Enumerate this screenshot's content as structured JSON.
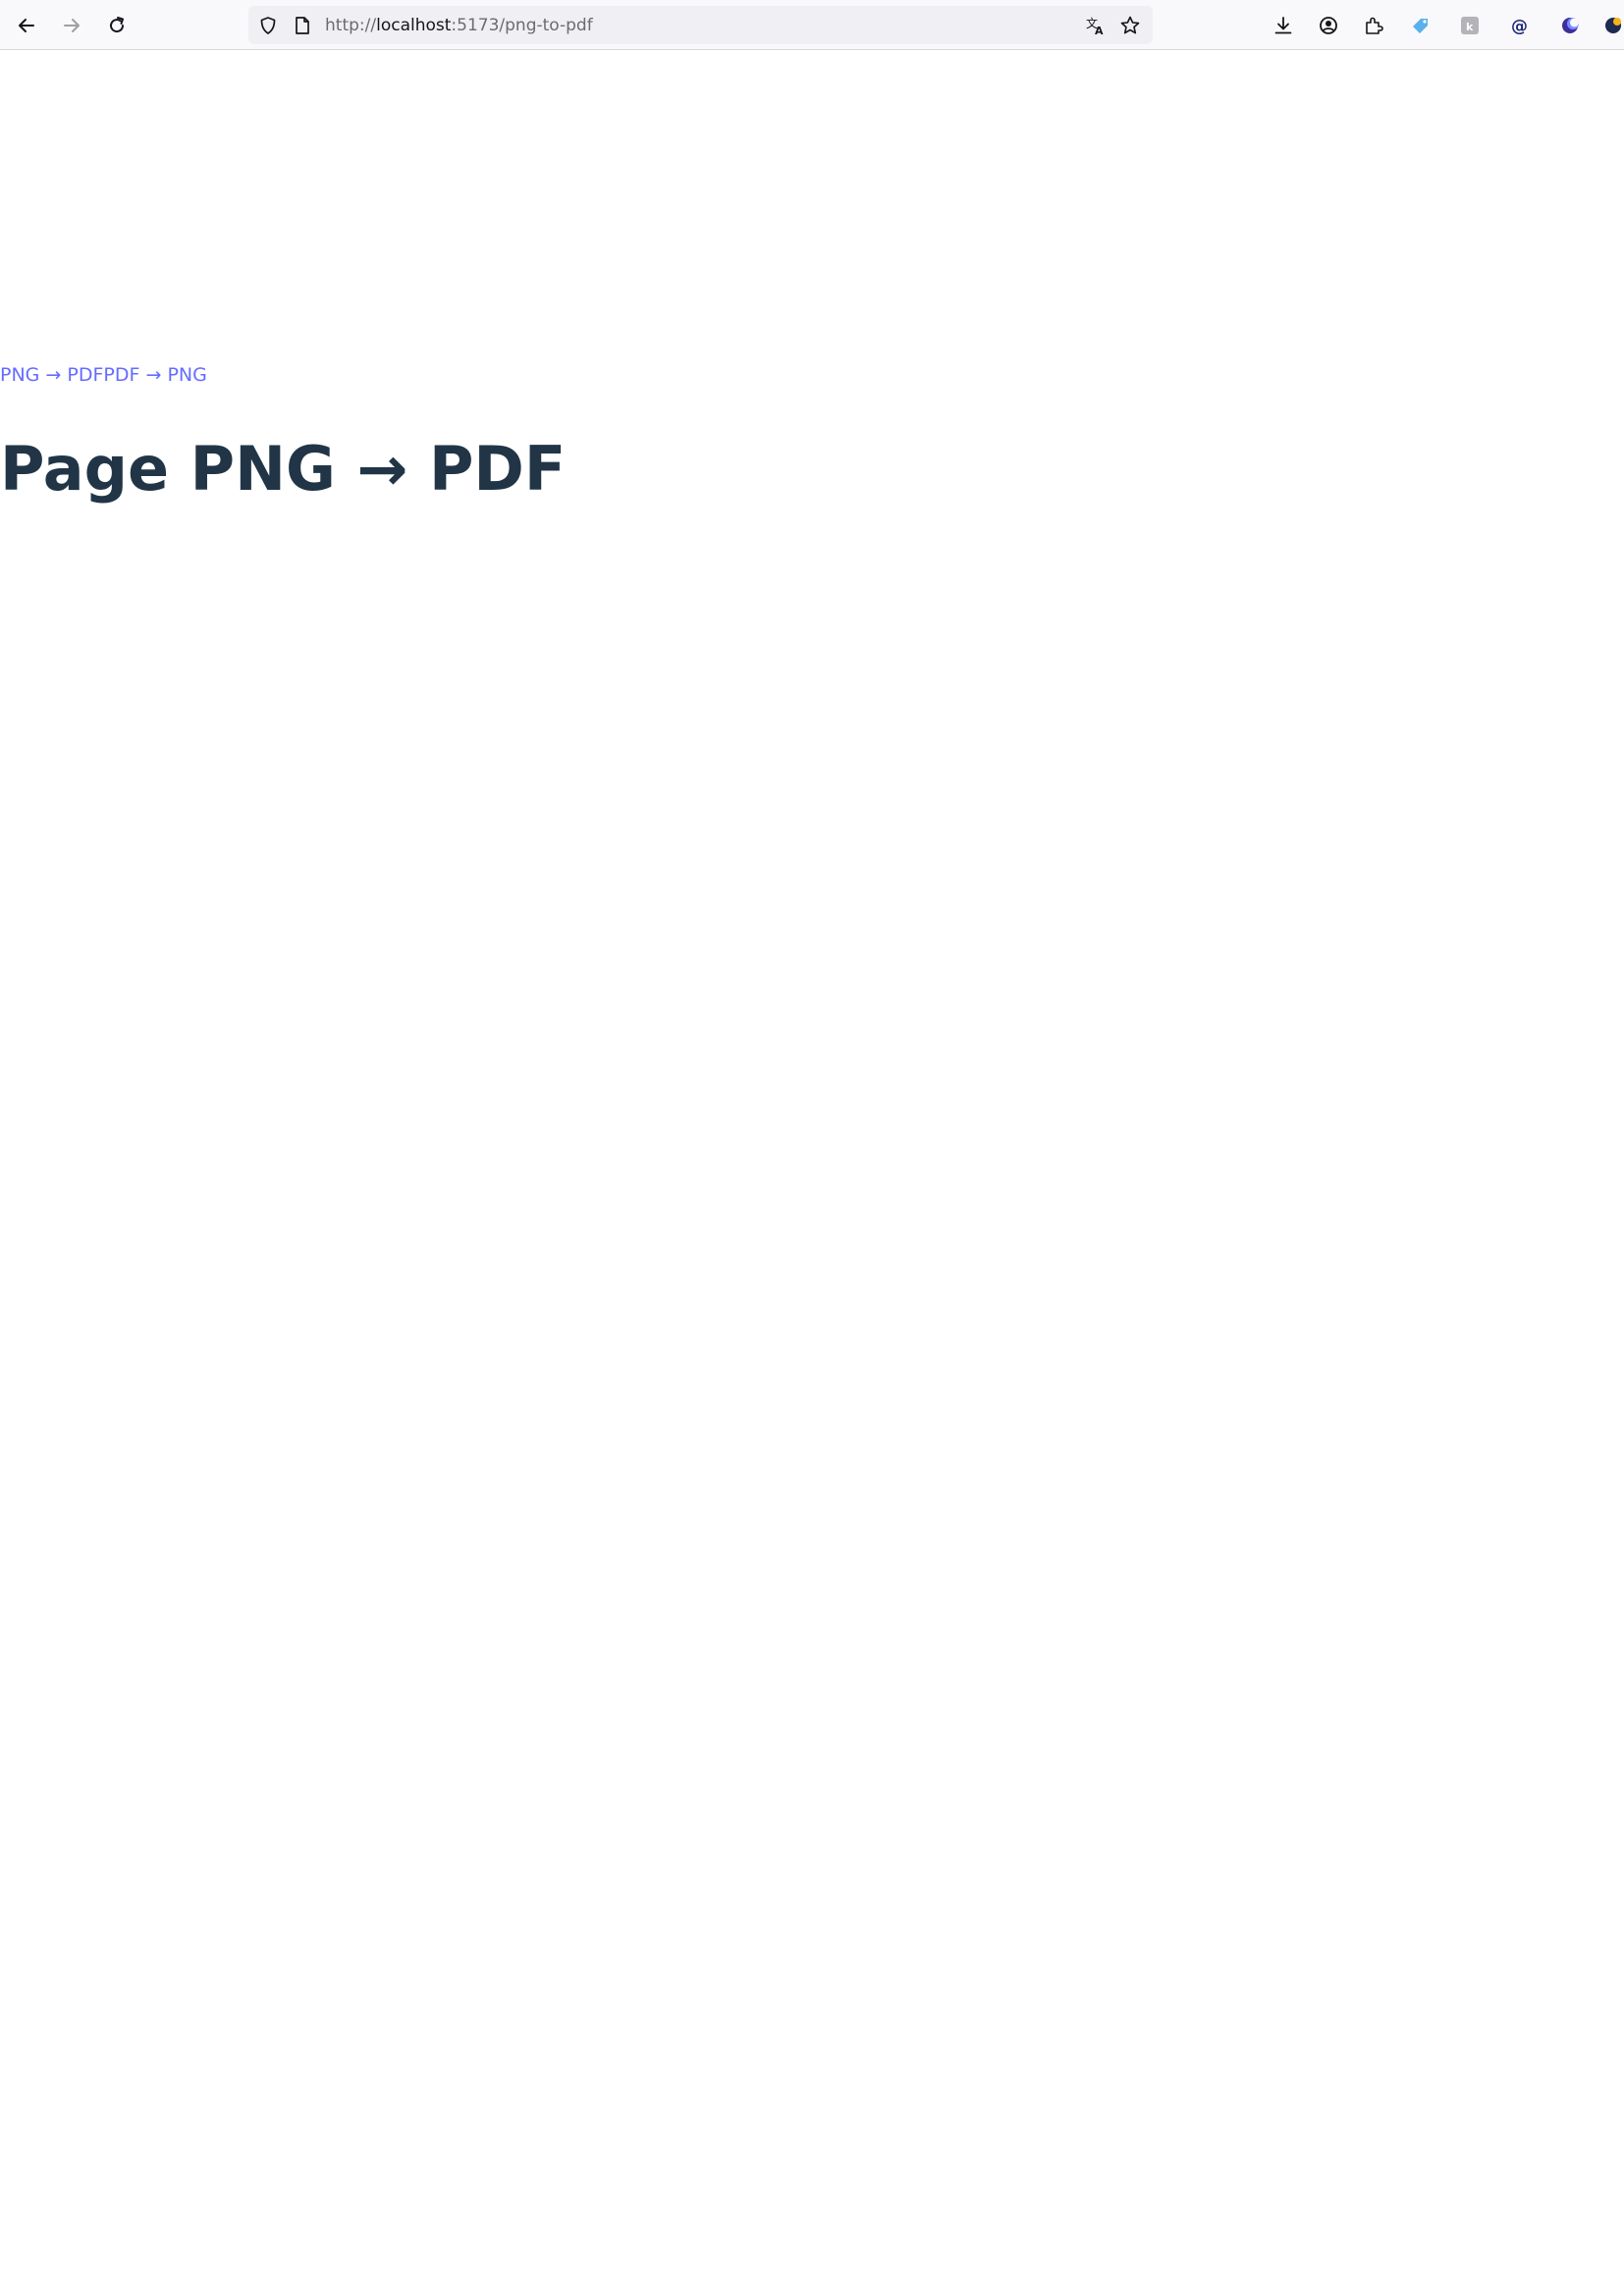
{
  "browser": {
    "url_scheme": "http://",
    "url_host": "localhost",
    "url_rest": ":5173/png-to-pdf"
  },
  "nav": {
    "links": [
      {
        "label": "PNG → PDF"
      },
      {
        "label": "PDF → PNG"
      }
    ]
  },
  "page": {
    "title": "Page PNG → PDF"
  },
  "colors": {
    "link": "#646cff",
    "title": "#213547",
    "toolbar_bg": "#f9f9fb",
    "urlbar_bg": "#f0f0f4"
  }
}
